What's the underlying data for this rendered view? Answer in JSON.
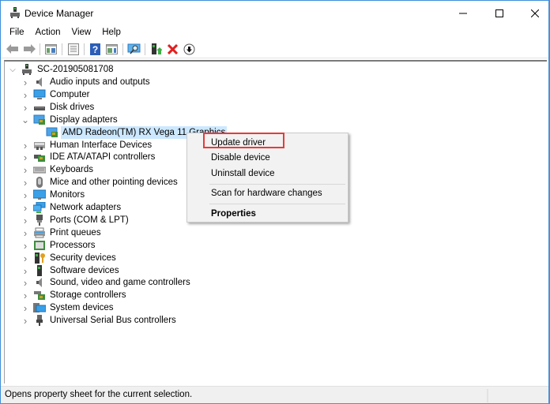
{
  "window": {
    "title": "Device Manager",
    "controls": [
      "minimize",
      "maximize",
      "close"
    ]
  },
  "menubar": {
    "items": [
      "File",
      "Action",
      "View",
      "Help"
    ]
  },
  "toolbar": {
    "buttons": [
      {
        "name": "back",
        "icon": "arrow-left-icon"
      },
      {
        "name": "forward",
        "icon": "arrow-right-icon"
      },
      {
        "name": "show-hide-console-tree",
        "icon": "console-tree-icon"
      },
      {
        "name": "properties",
        "icon": "properties-icon"
      },
      {
        "name": "help",
        "icon": "help-icon"
      },
      {
        "name": "show-action-pane",
        "icon": "action-pane-icon"
      },
      {
        "name": "scan-hardware",
        "icon": "scan-monitor-icon"
      },
      {
        "name": "update-driver",
        "icon": "update-driver-icon"
      },
      {
        "name": "uninstall-device",
        "icon": "red-x-icon"
      },
      {
        "name": "disable-device",
        "icon": "down-arrow-circle-icon"
      }
    ]
  },
  "tree": {
    "root": "SC-201905081708",
    "categories": [
      {
        "label": "Audio inputs and outputs",
        "icon": "speaker-icon",
        "expanded": false
      },
      {
        "label": "Computer",
        "icon": "computer-icon",
        "expanded": false
      },
      {
        "label": "Disk drives",
        "icon": "disk-drive-icon",
        "expanded": false
      },
      {
        "label": "Display adapters",
        "icon": "display-adapter-icon",
        "expanded": true,
        "children": [
          "AMD Radeon(TM) RX Vega 11 Graphics"
        ]
      },
      {
        "label": "Human Interface Devices",
        "icon": "hid-icon",
        "expanded": false
      },
      {
        "label": "IDE ATA/ATAPI controllers",
        "icon": "ide-controller-icon",
        "expanded": false
      },
      {
        "label": "Keyboards",
        "icon": "keyboard-icon",
        "expanded": false
      },
      {
        "label": "Mice and other pointing devices",
        "icon": "mouse-icon",
        "expanded": false
      },
      {
        "label": "Monitors",
        "icon": "monitor-icon",
        "expanded": false
      },
      {
        "label": "Network adapters",
        "icon": "network-icon",
        "expanded": false
      },
      {
        "label": "Ports (COM & LPT)",
        "icon": "port-icon",
        "expanded": false
      },
      {
        "label": "Print queues",
        "icon": "printer-icon",
        "expanded": false
      },
      {
        "label": "Processors",
        "icon": "processor-icon",
        "expanded": false
      },
      {
        "label": "Security devices",
        "icon": "security-key-icon",
        "expanded": false
      },
      {
        "label": "Software devices",
        "icon": "software-device-icon",
        "expanded": false
      },
      {
        "label": "Sound, video and game controllers",
        "icon": "speaker-icon",
        "expanded": false
      },
      {
        "label": "Storage controllers",
        "icon": "storage-controller-icon",
        "expanded": false
      },
      {
        "label": "System devices",
        "icon": "system-folder-icon",
        "expanded": false
      },
      {
        "label": "Universal Serial Bus controllers",
        "icon": "usb-icon",
        "expanded": false
      }
    ],
    "selected": "AMD Radeon(TM) RX Vega 11 Graphics"
  },
  "context_menu": {
    "items": [
      {
        "label": "Update driver",
        "highlighted": true,
        "bold": false
      },
      {
        "label": "Disable device",
        "bold": false
      },
      {
        "label": "Uninstall device",
        "bold": false
      },
      {
        "label": "Scan for hardware changes",
        "bold": false
      },
      {
        "label": "Properties",
        "bold": true
      }
    ],
    "highlight_color": "#e83a3a"
  },
  "statusbar": {
    "text": "Opens property sheet for the current selection."
  },
  "colors": {
    "window_border": "#3c8fd8",
    "selection": "#cce8ff",
    "menu_bg": "#f2f2f2"
  }
}
